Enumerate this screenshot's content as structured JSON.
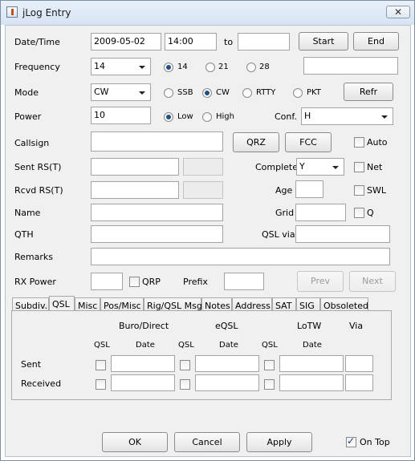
{
  "window": {
    "title": "jLog Entry",
    "close_glyph": "✕"
  },
  "datetime": {
    "label": "Date/Time",
    "date": "2009-05-02",
    "time": "14:00",
    "to_label": "to",
    "to_value": "",
    "start_button": "Start",
    "end_button": "End"
  },
  "frequency": {
    "label": "Frequency",
    "value": "14",
    "radios": [
      "14",
      "21",
      "28"
    ],
    "selected": "14",
    "extra_value": ""
  },
  "mode": {
    "label": "Mode",
    "value": "CW",
    "radios": [
      "SSB",
      "CW",
      "RTTY",
      "PKT"
    ],
    "selected": "CW",
    "refr_button": "Refr"
  },
  "power": {
    "label": "Power",
    "value": "10",
    "radios": [
      "Low",
      "High"
    ],
    "selected": "Low",
    "conf_label": "Conf.",
    "conf_value": "H"
  },
  "callsign": {
    "label": "Callsign",
    "value": "",
    "qrz_button": "QRZ",
    "fcc_button": "FCC",
    "auto_label": "Auto"
  },
  "sent_rst": {
    "label": "Sent RS(T)",
    "value": "",
    "complete_label": "Complete",
    "complete_value": "Y",
    "net_label": "Net"
  },
  "rcvd_rst": {
    "label": "Rcvd RS(T)",
    "value": "",
    "age_label": "Age",
    "age_value": "",
    "swl_label": "SWL"
  },
  "name": {
    "label": "Name",
    "value": "",
    "grid_label": "Grid",
    "grid_value": "",
    "q_label": "Q"
  },
  "qth": {
    "label": "QTH",
    "value": "",
    "qsl_via_label": "QSL via",
    "qsl_via_value": ""
  },
  "remarks": {
    "label": "Remarks",
    "value": ""
  },
  "rx_power": {
    "label": "RX Power",
    "value": "",
    "qrp_label": "QRP",
    "prefix_label": "Prefix",
    "prefix_value": "",
    "prev_button": "Prev",
    "next_button": "Next"
  },
  "tabs": [
    "Subdiv.",
    "QSL",
    "Misc",
    "Pos/Misc",
    "Rig/QSL Msg",
    "Notes",
    "Address",
    "SAT",
    "SIG",
    "Obsoleted"
  ],
  "active_tab": "QSL",
  "qsl_panel": {
    "group_headers": [
      "Buro/Direct",
      "eQSL",
      "LoTW",
      "Via"
    ],
    "sub_qsl": "QSL",
    "sub_date": "Date",
    "rows": [
      "Sent",
      "Received"
    ]
  },
  "footer": {
    "ok_button": "OK",
    "cancel_button": "Cancel",
    "apply_button": "Apply",
    "on_top_label": "On Top"
  }
}
